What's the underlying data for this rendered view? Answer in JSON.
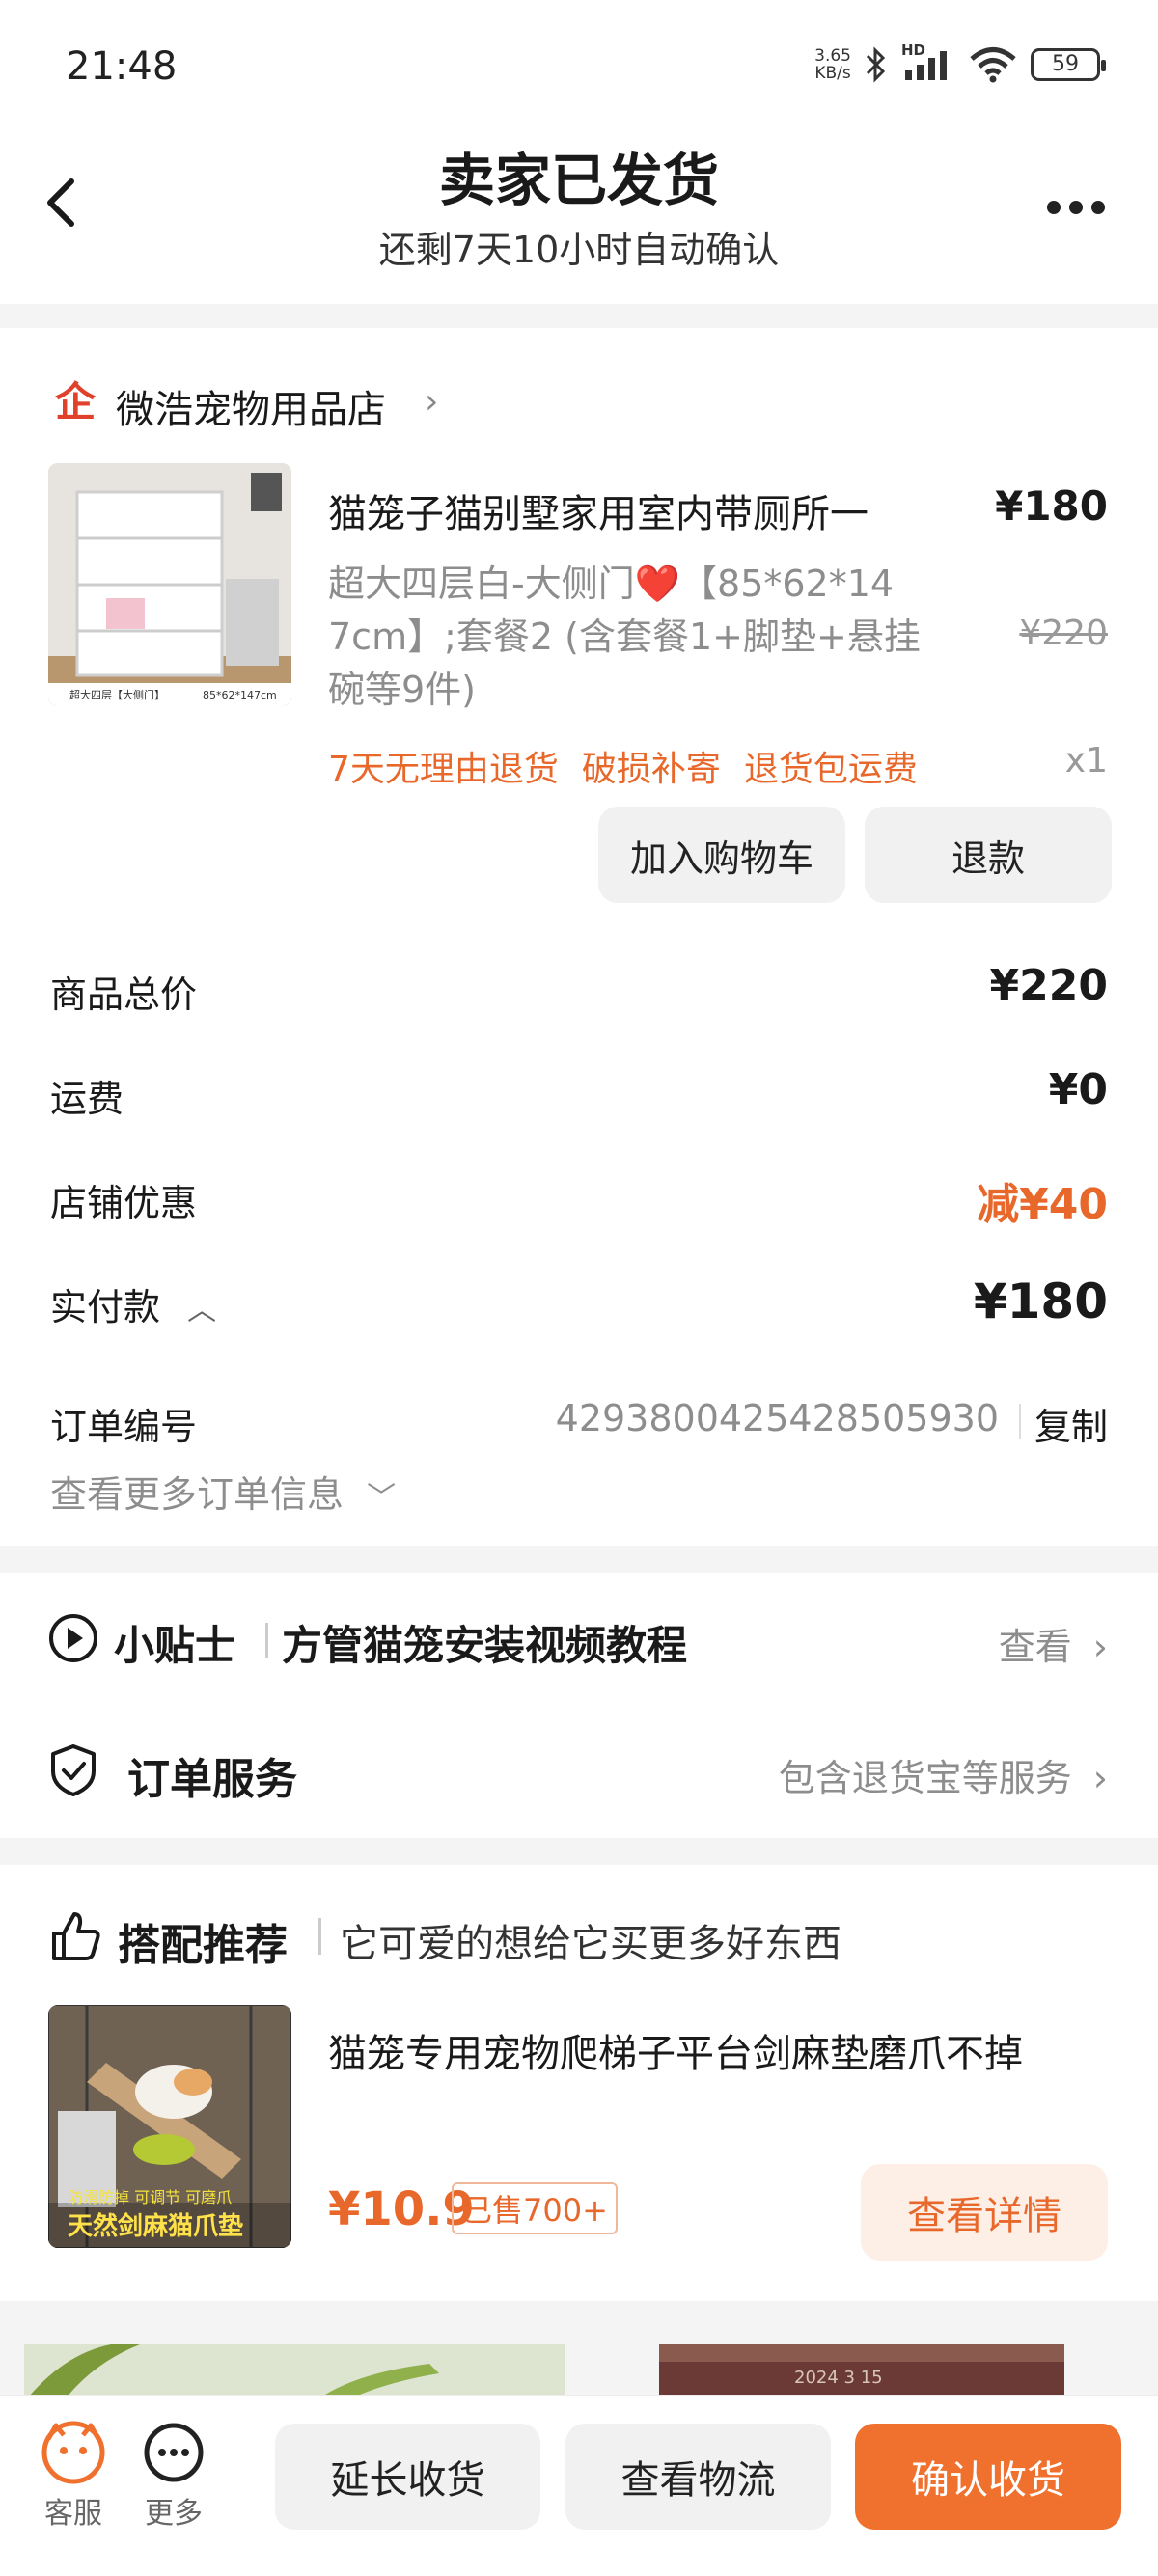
{
  "status_bar": {
    "time": "21:48",
    "net_speed_value": "3.65",
    "net_speed_unit": "KB/s",
    "network": "HD",
    "battery": "59"
  },
  "header": {
    "title": "卖家已发货",
    "subtitle": "还剩7天10小时自动确认"
  },
  "shop": {
    "name": "微浩宠物用品店",
    "logo_text": "企"
  },
  "product": {
    "title": "猫笼子猫别墅家用室内带厕所一",
    "price": "¥180",
    "spec_line1": "超大四层白-大侧门❤️【85*62*14",
    "spec_line2": "7cm】;套餐2 (含套餐1+脚垫+悬挂",
    "spec_line3": "碗等9件)",
    "original_price": "¥220",
    "tags": [
      "7天无理由退货",
      "破损补寄",
      "退货包运费"
    ],
    "quantity": "x1",
    "image_caption_left": "超大四层【大侧门】",
    "image_caption_right": "85*62*147cm",
    "add_cart_label": "加入购物车",
    "refund_label": "退款"
  },
  "summary": {
    "goods_total_label": "商品总价",
    "goods_total_value": "¥220",
    "shipping_label": "运费",
    "shipping_value": "¥0",
    "discount_label": "店铺优惠",
    "discount_value": "减¥40",
    "paid_label": "实付款",
    "paid_value": "¥180",
    "order_no_label": "订单编号",
    "order_no_value": "4293800425428505930",
    "copy_label": "复制",
    "more_info_label": "查看更多订单信息"
  },
  "tips": {
    "label": "小贴士",
    "text": "方管猫笼安装视频教程",
    "view_label": "查看",
    "service_label": "订单服务",
    "service_desc": "包含退货宝等服务"
  },
  "recommendation": {
    "label": "搭配推荐",
    "subtitle": "它可爱的想给它买更多好东西",
    "item_title": "猫笼专用宠物爬梯子平台剑麻垫磨爪不掉",
    "item_price": "¥10.9",
    "item_sold": "已售700+",
    "detail_label": "查看详情",
    "image_caption_top": "防滑防掉 可调节 可磨爪",
    "image_caption": "天然剑麻猫爪垫"
  },
  "peek": {
    "stamp_text": "2024 3 15"
  },
  "bottom_bar": {
    "service_label": "客服",
    "more_label": "更多",
    "extend_label": "延长收货",
    "logistics_label": "查看物流",
    "confirm_label": "确认收货"
  },
  "colors": {
    "accent": "#f0702e",
    "accent_text": "#e8682b",
    "muted": "#8d8d8d"
  }
}
